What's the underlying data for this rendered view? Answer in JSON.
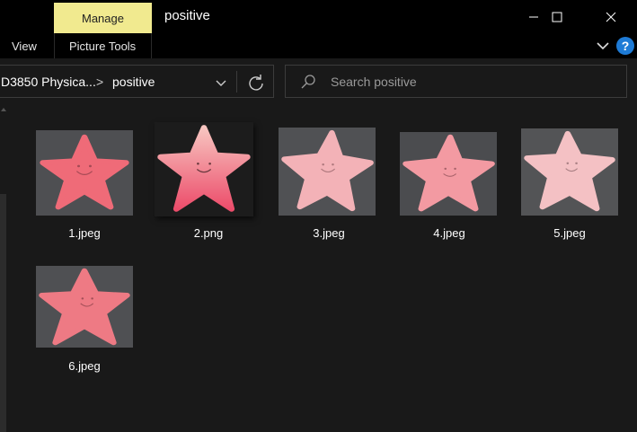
{
  "window": {
    "title": "positive",
    "manage_tab": "Manage"
  },
  "ribbon": {
    "tabs": [
      "View",
      "Picture Tools"
    ],
    "help": "?"
  },
  "address": {
    "path_parent": "D3850 Physica...",
    "separator": ">",
    "current_folder": "positive"
  },
  "search": {
    "placeholder": "Search positive"
  },
  "files": [
    {
      "name": "1.jpeg",
      "kind": "photo",
      "star_color": "#ef6b78"
    },
    {
      "name": "2.png",
      "kind": "png",
      "star_color": "#f07a88"
    },
    {
      "name": "3.jpeg",
      "kind": "photo",
      "star_color": "#f3b2b7"
    },
    {
      "name": "4.jpeg",
      "kind": "photo",
      "star_color": "#f39aa2"
    },
    {
      "name": "5.jpeg",
      "kind": "photo",
      "star_color": "#f4c1c4"
    },
    {
      "name": "6.jpeg",
      "kind": "photo",
      "star_color": "#ee7a84"
    }
  ],
  "colors": {
    "background": "#191919",
    "titlebar": "#000000",
    "manage_tab": "#f1ea8f",
    "help_blue": "#1e7bd6"
  }
}
